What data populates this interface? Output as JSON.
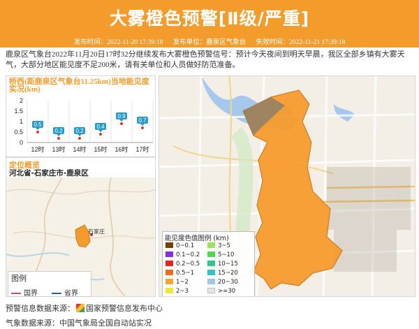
{
  "header": {
    "title": "大雾橙色预警[Ⅱ级/严重]",
    "publish_time": "发布时间：2022-11-20 17:39:18",
    "publisher": "发布单位：鹿泉区气象台",
    "expire_time": "失效时间：2022-11-21 17:39:18",
    "color": "#f39c2c"
  },
  "description": "鹿泉区气象台2022年11月20日17时32分继续发布大雾橙色预警信号：预计今天夜间到明天早晨，我区全部乡镇有大雾天气，大部分地区能见度不足200米，请有关单位和人员做好防范准备。",
  "chart": {
    "title": "桥西(距鹿泉区气象台11.25km)当地能见度实况(km)"
  },
  "chart_data": {
    "type": "line",
    "categories": [
      "12时",
      "13时",
      "14时",
      "15时",
      "16时",
      "17时"
    ],
    "values": [
      0.5,
      0.2,
      0.2,
      0.4,
      0.9,
      0.7
    ],
    "yticks": [
      0,
      0.5,
      1,
      1.5,
      2
    ],
    "ylim": [
      0,
      2
    ],
    "grid": true,
    "label_color": "#2a9ac9"
  },
  "location": {
    "title": "定位概览",
    "name": "河北省-石家庄市-鹿泉区",
    "map_label": "石家庄"
  },
  "map_legend": {
    "title": "图例",
    "items": [
      {
        "label": "国界",
        "color": "#c0506e"
      },
      {
        "label": "省界",
        "color": "#1f5fb0"
      }
    ]
  },
  "visibility_legend": {
    "title": "能见度色值图例 (km)",
    "items": [
      {
        "label": "0~0.1",
        "color": "#7b3f00"
      },
      {
        "label": "3~5",
        "color": "#9be45a"
      },
      {
        "label": "0.1~0.2",
        "color": "#8a2be2"
      },
      {
        "label": "5~10",
        "color": "#53d653"
      },
      {
        "label": "0.2~0.5",
        "color": "#e8231f"
      },
      {
        "label": "10~15",
        "color": "#32c88a"
      },
      {
        "label": "0.5~1",
        "color": "#f06a1c"
      },
      {
        "label": "15~20",
        "color": "#35c0c8"
      },
      {
        "label": "1~2",
        "color": "#f7a431"
      },
      {
        "label": "20~30",
        "color": "#9ec8e8"
      },
      {
        "label": "2~3",
        "color": "#f1e53a"
      },
      {
        "label": ">=30",
        "color": "#e6e6e6"
      }
    ]
  },
  "footer": {
    "warning_source": "预警信息数据来源：",
    "warning_source_name": "国家预警信息发布中心",
    "weather_source": "气象数据来源：中国气象局全国自动站实况"
  }
}
